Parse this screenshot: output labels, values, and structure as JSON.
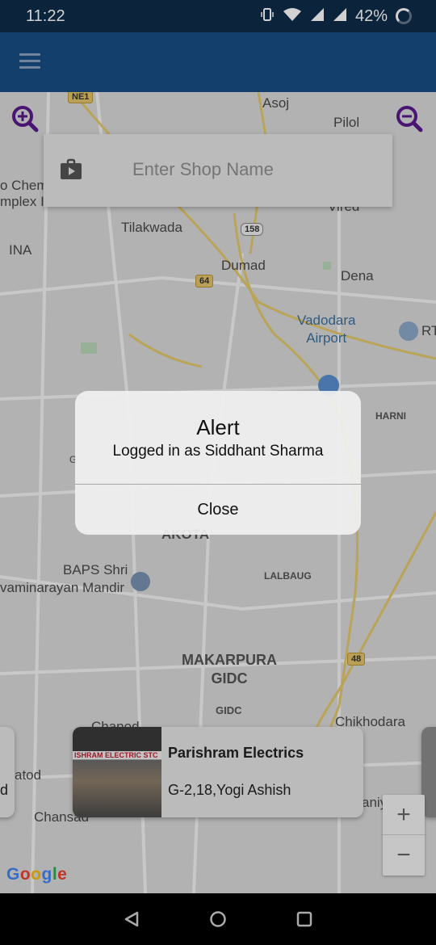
{
  "status_bar": {
    "time": "11:22",
    "battery": "42%",
    "icons": [
      "vibrate-icon",
      "wifi-icon",
      "signal-icon",
      "signal-roaming-icon",
      "battery-saver-icon"
    ]
  },
  "app_bar": {
    "menu_icon": "hamburger-menu-icon",
    "color": "#174e84"
  },
  "search": {
    "placeholder": "Enter Shop Name",
    "value": "",
    "icon": "shop-bag-icon"
  },
  "map_labels": {
    "asoj": "Asoj",
    "pilol": "Pilol",
    "chem": "o Chem",
    "complex": "mplex I",
    "ina": "INA",
    "tilakwada": "Tilakwada",
    "dumad": "Dumad",
    "dena": "Dena",
    "vadodara_airport": "Vadodara\nAirport",
    "rt": "RT",
    "harni": "HARNI",
    "akota": "AKOTA",
    "baps": "BAPS Shri",
    "swaminarayan": "vaminarayan Mandir",
    "lalbaug": "LALBAUG",
    "makarpura": "MAKARPURA\nGIDC",
    "gidc": "GIDC",
    "chikhodara": "Chikhodara",
    "chanod": "Chanod",
    "atod": "atod",
    "chansad": "Chansad",
    "aniyavi": "aniyavi",
    "vired": "Vired",
    "g": "G",
    "ne1": "NE1",
    "r158": "158",
    "r64": "64",
    "r48": "48"
  },
  "shop_card": {
    "name": "Parishram Electrics",
    "address": "G-2,18,Yogi Ashish",
    "thumb_sign": "ISHRAM ELECTRIC STC"
  },
  "side_card_left": {
    "text": "d"
  },
  "google": {
    "letters": [
      "G",
      "o",
      "o",
      "g",
      "l",
      "e"
    ],
    "colors": [
      "#4285f4",
      "#ea4335",
      "#fbbc05",
      "#4285f4",
      "#34a853",
      "#ea4335"
    ]
  },
  "alert": {
    "title": "Alert",
    "message": "Logged in as Siddhant Sharma",
    "close_label": "Close"
  },
  "map_zoom": {
    "plus": "+",
    "minus": "−"
  },
  "nav_bar": {
    "icons": [
      "back-icon",
      "home-icon",
      "recents-icon"
    ]
  },
  "colors": {
    "accent_purple": "#5a1a8c",
    "primary": "#174e84",
    "status_bar": "#0e2d4a"
  }
}
